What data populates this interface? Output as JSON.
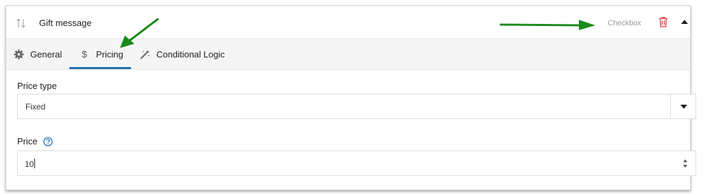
{
  "field": {
    "title": "Gift message",
    "type_label": "Checkbox"
  },
  "tabs": [
    {
      "label": "General",
      "icon": "gear-icon"
    },
    {
      "label": "Pricing",
      "icon": "dollar-icon",
      "active": true
    },
    {
      "label": "Conditional Logic",
      "icon": "magic-wand-icon"
    }
  ],
  "form": {
    "price_type": {
      "label": "Price type",
      "value": "Fixed"
    },
    "price": {
      "label": "Price",
      "value": "10"
    }
  },
  "colors": {
    "accent": "#2271b1",
    "delete": "#d63638",
    "annotation_arrow": "#1c8a1c"
  }
}
